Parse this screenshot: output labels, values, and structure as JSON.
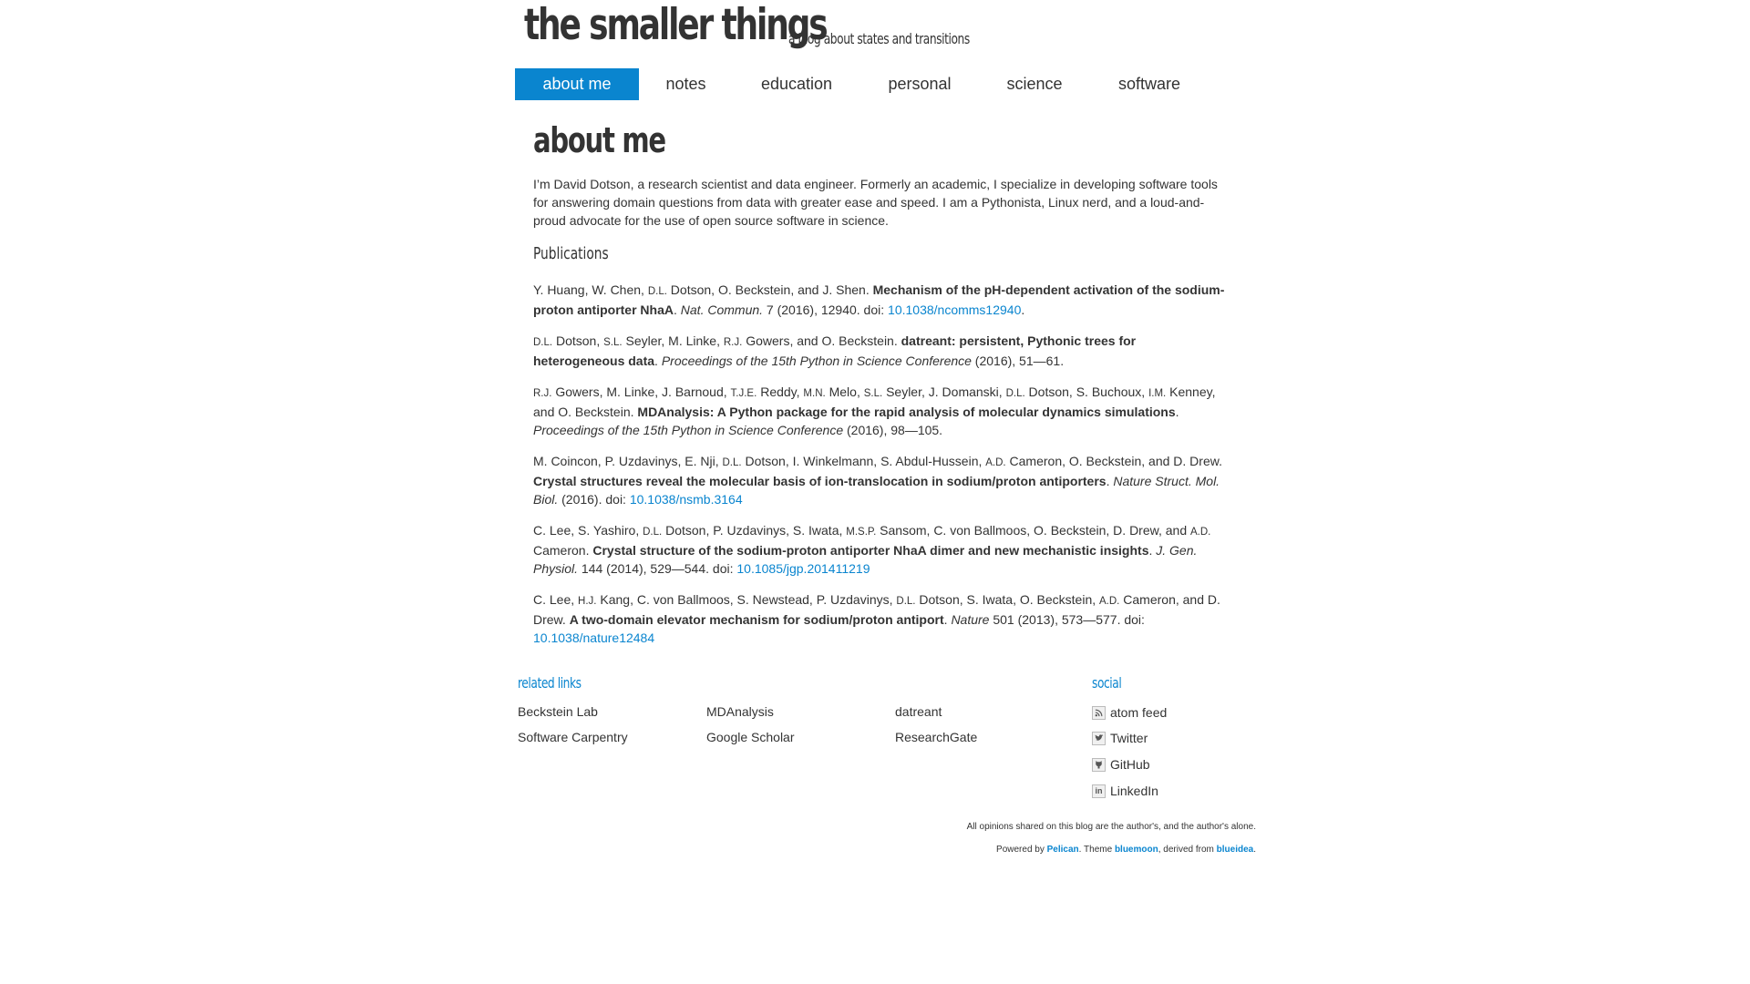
{
  "header": {
    "site_title": "the smaller things",
    "tagline": "a blog about states and transitions"
  },
  "nav": [
    {
      "label": "about me",
      "active": true
    },
    {
      "label": "notes"
    },
    {
      "label": "education"
    },
    {
      "label": "personal"
    },
    {
      "label": "science"
    },
    {
      "label": "software"
    }
  ],
  "page": {
    "title": "about me",
    "intro": "I’m David Dotson, a research scientist and data engineer. Formerly an academic, I specialize in developing software tools for answering domain questions from data with greater ease and speed. I am a Pythonista, Linux nerd, and a loud-and-proud advocate for the use of open source software in science.",
    "publications_heading": "Publications"
  },
  "publications": [
    {
      "authors_html": "Y. Huang, W. Chen, <span class=\"sc\">D.L.</span> Dotson, O. Beckstein, and J. Shen.",
      "title": "Mechanism of the pH-dependent activation of the sodium-proton antiporter NhaA",
      "journal": "Nat. Commun.",
      "details": " 7 (2016), 12940. doi: ",
      "doi": "10.1038/ncomms12940",
      "trail": "."
    },
    {
      "authors_html": "<span class=\"sc\">D.L.</span> Dotson, <span class=\"sc\">S.L.</span> Seyler, M. Linke, <span class=\"sc\">R.J.</span> Gowers, and O. Beckstein.",
      "title": "datreant: persistent, Pythonic trees for heterogeneous data",
      "journal": "Proceedings of the 15th Python in Science Conference",
      "details": " (2016), 51—61.",
      "doi": "",
      "trail": ""
    },
    {
      "authors_html": "<span class=\"sc\">R.J.</span> Gowers, M. Linke, J. Barnoud, <span class=\"sc\">T.J.E.</span> Reddy, <span class=\"sc\">M.N.</span> Melo, <span class=\"sc\">S.L.</span> Seyler, J. Domanski, <span class=\"sc\">D.L.</span> Dotson, S. Buchoux, <span class=\"sc\">I.M.</span> Kenney, and O. Beckstein.",
      "title": "MDAnalysis: A Python package for the rapid analysis of molecular dynamics simulations",
      "journal": "Proceedings of the 15th Python in Science Conference",
      "details": " (2016), 98—105.",
      "doi": "",
      "trail": ""
    },
    {
      "authors_html": "M. Coincon, P. Uzdavinys, E. Nji, <span class=\"sc\">D.L.</span> Dotson, I. Winkelmann, S. Abdul-Hussein, <span class=\"sc\">A.D.</span> Cameron, O. Beckstein, and D. Drew.",
      "title": "Crystal structures reveal the molecular basis of ion-translocation in sodium/proton antiporters",
      "journal": "Nature Struct. Mol. Biol.",
      "details": " (2016). doi: ",
      "doi": "10.1038/nsmb.3164",
      "trail": ""
    },
    {
      "authors_html": "C. Lee, S. Yashiro, <span class=\"sc\">D.L.</span> Dotson, P. Uzdavinys, S. Iwata, <span class=\"sc\">M.S.P.</span> Sansom, C. von Ballmoos, O. Beckstein, D. Drew, and <span class=\"sc\">A.D.</span> Cameron.",
      "title": "Crystal structure of the sodium-proton antiporter NhaA dimer and new mechanistic insights",
      "journal": "J. Gen. Physiol.",
      "details": " 144 (2014), 529—544. doi: ",
      "doi": "10.1085/jgp.201411219",
      "trail": ""
    },
    {
      "authors_html": "C. Lee, <span class=\"sc\">H.J.</span> Kang, C. von Ballmoos, S. Newstead, P. Uzdavinys, <span class=\"sc\">D.L.</span> Dotson, S. Iwata, O. Beckstein, <span class=\"sc\">A.D.</span> Cameron, and D. Drew.",
      "title": "A two-domain elevator mechanism for sodium/proton antiport",
      "journal": "Nature",
      "details": " 501 (2013), 573—577. doi: ",
      "doi": "10.1038/nature12484",
      "trail": ""
    }
  ],
  "related_links": {
    "heading": "related links",
    "items": [
      "Beckstein Lab",
      "MDAnalysis",
      "datreant",
      "Software Carpentry",
      "Google Scholar",
      "ResearchGate"
    ]
  },
  "social": {
    "heading": "social",
    "items": [
      {
        "label": "atom feed",
        "icon": "rss-icon"
      },
      {
        "label": "Twitter",
        "icon": "twitter-icon"
      },
      {
        "label": "GitHub",
        "icon": "github-icon"
      },
      {
        "label": "LinkedIn",
        "icon": "linkedin-icon"
      }
    ]
  },
  "footer": {
    "disclaimer": "All opinions shared on this blog are the author's, and the author's alone.",
    "powered_prefix": "Powered by ",
    "pelican": "Pelican",
    "theme_text": ". Theme ",
    "bluemoon": "bluemoon",
    "derived_text": ", derived from ",
    "blueidea": "blueidea",
    "end": "."
  },
  "colors": {
    "accent": "#0a85cf",
    "text": "#333333"
  }
}
